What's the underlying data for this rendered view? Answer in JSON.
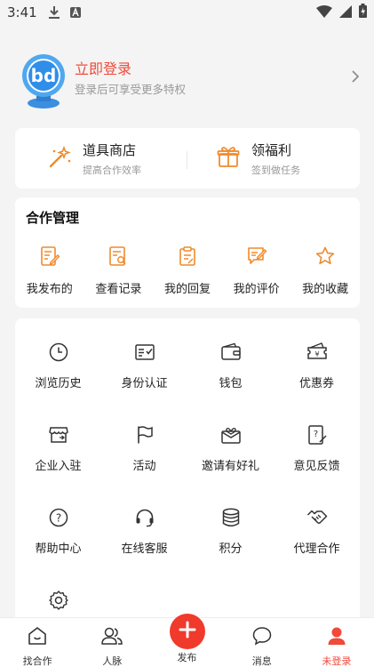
{
  "status_bar": {
    "time": "3:41"
  },
  "profile": {
    "title": "立即登录",
    "subtitle": "登录后可享受更多特权"
  },
  "quick": [
    {
      "title": "道具商店",
      "subtitle": "提高合作效率",
      "icon": "magic-wand-icon"
    },
    {
      "title": "领福利",
      "subtitle": "签到做任务",
      "icon": "gift-icon"
    }
  ],
  "cooperation": {
    "title": "合作管理",
    "items": [
      {
        "label": "我发布的",
        "icon": "document-edit-icon"
      },
      {
        "label": "查看记录",
        "icon": "document-search-icon"
      },
      {
        "label": "我的回复",
        "icon": "clipboard-icon"
      },
      {
        "label": "我的评价",
        "icon": "comment-edit-icon"
      },
      {
        "label": "我的收藏",
        "icon": "star-icon"
      }
    ]
  },
  "services": [
    {
      "label": "浏览历史",
      "icon": "clock-icon"
    },
    {
      "label": "身份认证",
      "icon": "id-card-icon"
    },
    {
      "label": "钱包",
      "icon": "wallet-icon"
    },
    {
      "label": "优惠券",
      "icon": "coupon-icon"
    },
    {
      "label": "企业入驻",
      "icon": "store-icon"
    },
    {
      "label": "活动",
      "icon": "flag-icon"
    },
    {
      "label": "邀请有好礼",
      "icon": "invite-envelope-icon"
    },
    {
      "label": "意见反馈",
      "icon": "feedback-icon"
    },
    {
      "label": "帮助中心",
      "icon": "help-icon"
    },
    {
      "label": "在线客服",
      "icon": "headset-icon"
    },
    {
      "label": "积分",
      "icon": "coins-icon"
    },
    {
      "label": "代理合作",
      "icon": "handshake-icon"
    },
    {
      "label": "",
      "icon": "settings-icon"
    }
  ],
  "tabbar": {
    "tabs": [
      {
        "label": "找合作",
        "icon": "home-icon"
      },
      {
        "label": "人脉",
        "icon": "people-icon"
      },
      {
        "label": "发布",
        "icon": "plus-icon"
      },
      {
        "label": "消息",
        "icon": "chat-icon"
      },
      {
        "label": "未登录",
        "icon": "user-icon",
        "active": true
      }
    ]
  },
  "colors": {
    "accent": "#f04a3a",
    "icon_orange": "#f08a2c",
    "publish_button": "#f03a2c"
  }
}
